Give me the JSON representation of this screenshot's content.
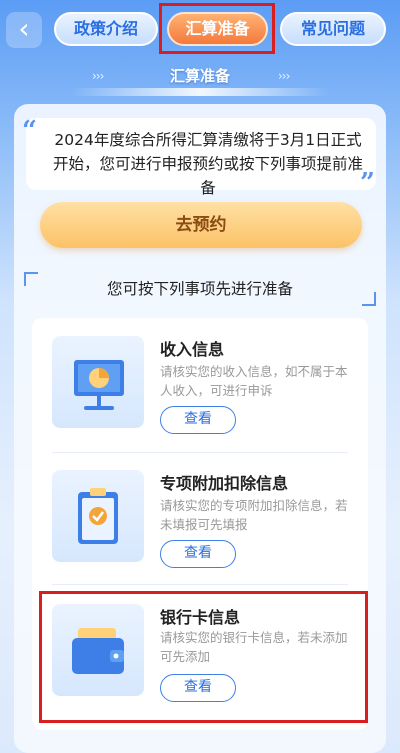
{
  "header": {
    "back_icon": "chevron-left-icon",
    "tabs": [
      {
        "label": "政策介绍"
      },
      {
        "label": "汇算准备"
      },
      {
        "label": "常见问题"
      }
    ],
    "highlight_color": "#d81e1e"
  },
  "section": {
    "title": "汇算准备",
    "left_arrows": "›››",
    "right_arrows": "›››"
  },
  "notice": {
    "text": "2024年度综合所得汇算清缴将于3月1日正式开始，您可进行申报预约或按下列事项提前准备"
  },
  "reserve_button": {
    "label": "去预约"
  },
  "prep": {
    "title": "您可按下列事项先进行准备"
  },
  "items": [
    {
      "title": "收入信息",
      "desc": "请核实您的收入信息，如不属于本人收入，可进行申诉",
      "button": "查看",
      "icon": "presentation-chart-icon"
    },
    {
      "title": "专项附加扣除信息",
      "desc": "请核实您的专项附加扣除信息，若未填报可先填报",
      "button": "查看",
      "icon": "clipboard-check-icon"
    },
    {
      "title": "银行卡信息",
      "desc": "请核实您的银行卡信息，若未添加可先添加",
      "button": "查看",
      "icon": "wallet-icon"
    }
  ],
  "colors": {
    "accent": "#2a6fe0",
    "active_tab": "#f47a3c",
    "reserve": "#fbc266"
  }
}
